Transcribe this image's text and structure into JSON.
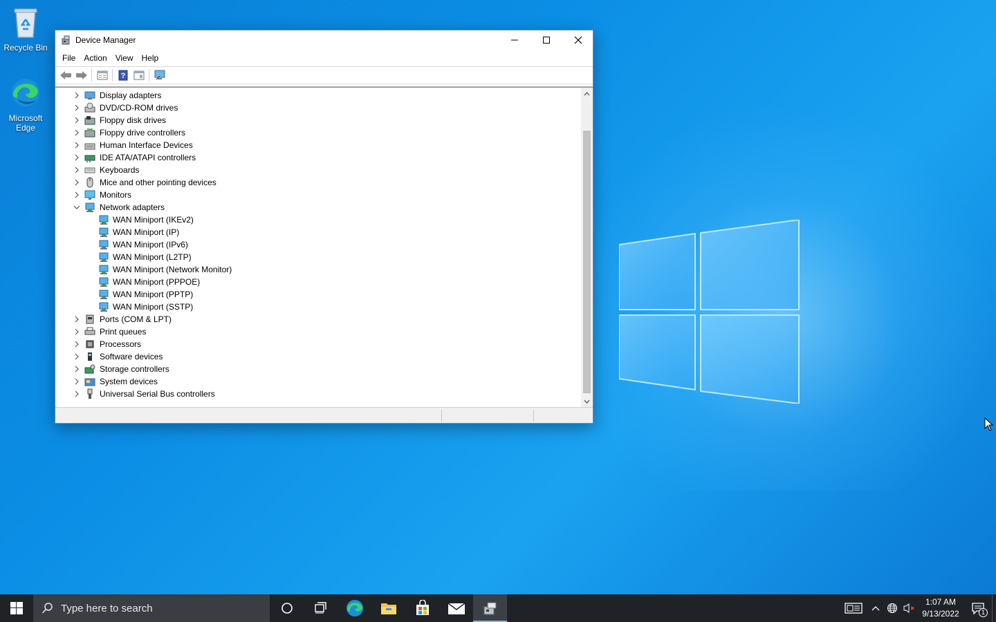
{
  "desktop": {
    "icons": [
      {
        "label": "Recycle Bin",
        "icon": "recycle-bin-icon"
      },
      {
        "label": "Microsoft Edge",
        "icon": "edge-icon"
      }
    ]
  },
  "window": {
    "title": "Device Manager",
    "menu": [
      "File",
      "Action",
      "View",
      "Help"
    ],
    "toolbar": [
      "back-icon",
      "forward-icon",
      "properties-icon",
      "help-icon",
      "view-icon",
      "scan-hardware-icon"
    ],
    "tree": [
      {
        "label": "Display adapters",
        "icon": "display-adapter-icon",
        "expanded": false
      },
      {
        "label": "DVD/CD-ROM drives",
        "icon": "dvd-drive-icon",
        "expanded": false
      },
      {
        "label": "Floppy disk drives",
        "icon": "floppy-disk-icon",
        "expanded": false
      },
      {
        "label": "Floppy drive controllers",
        "icon": "floppy-controller-icon",
        "expanded": false
      },
      {
        "label": "Human Interface Devices",
        "icon": "hid-icon",
        "expanded": false
      },
      {
        "label": "IDE ATA/ATAPI controllers",
        "icon": "ide-controller-icon",
        "expanded": false
      },
      {
        "label": "Keyboards",
        "icon": "keyboard-icon",
        "expanded": false
      },
      {
        "label": "Mice and other pointing devices",
        "icon": "mouse-icon",
        "expanded": false
      },
      {
        "label": "Monitors",
        "icon": "monitor-icon",
        "expanded": false
      },
      {
        "label": "Network adapters",
        "icon": "network-adapter-icon",
        "expanded": true,
        "children": [
          "WAN Miniport (IKEv2)",
          "WAN Miniport (IP)",
          "WAN Miniport (IPv6)",
          "WAN Miniport (L2TP)",
          "WAN Miniport (Network Monitor)",
          "WAN Miniport (PPPOE)",
          "WAN Miniport (PPTP)",
          "WAN Miniport (SSTP)"
        ]
      },
      {
        "label": "Ports (COM & LPT)",
        "icon": "port-icon",
        "expanded": false
      },
      {
        "label": "Print queues",
        "icon": "printer-icon",
        "expanded": false
      },
      {
        "label": "Processors",
        "icon": "processor-icon",
        "expanded": false
      },
      {
        "label": "Software devices",
        "icon": "software-device-icon",
        "expanded": false
      },
      {
        "label": "Storage controllers",
        "icon": "storage-controller-icon",
        "expanded": false
      },
      {
        "label": "System devices",
        "icon": "system-device-icon",
        "expanded": false
      },
      {
        "label": "Universal Serial Bus controllers",
        "icon": "usb-icon",
        "expanded": false
      }
    ]
  },
  "taskbar": {
    "search_placeholder": "Type here to search",
    "apps": [
      "cortana-icon",
      "task-view-icon",
      "edge-icon",
      "file-explorer-icon",
      "store-icon",
      "mail-icon",
      "device-manager-icon"
    ],
    "time": "1:07 AM",
    "date": "9/13/2022",
    "notification_count": "1"
  },
  "colors": {
    "accent": "#0078d7",
    "taskbar": "#1f2328",
    "desktop": "#0a84dc"
  }
}
